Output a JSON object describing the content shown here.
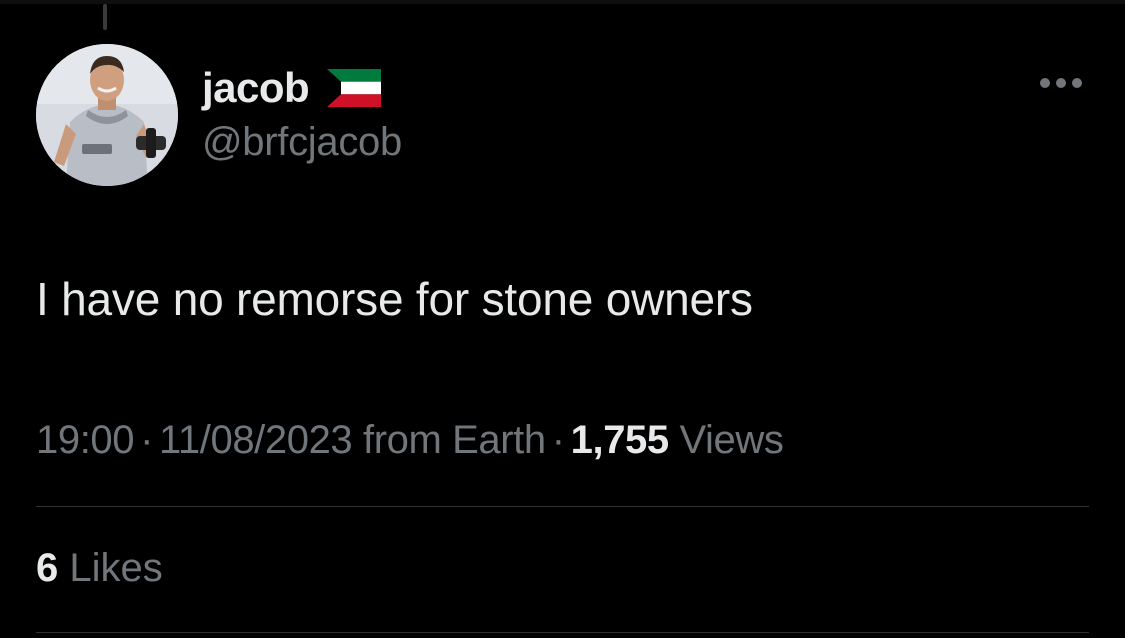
{
  "author": {
    "display_name": "jacob",
    "flag_icon": "kuwait-flag-icon",
    "handle": "@brfcjacob",
    "avatar_icon": "profile-photo"
  },
  "tweet": {
    "text": "I have no remorse for stone owners"
  },
  "meta": {
    "time": "19:00",
    "separator": "·",
    "date": "11/08/2023",
    "source": "from Earth",
    "views_count": "1,755",
    "views_label": "Views"
  },
  "engagement": {
    "likes_count": "6",
    "likes_label": "Likes"
  },
  "colors": {
    "background": "#000000",
    "primary_text": "#e7e9ea",
    "secondary_text": "#71767b",
    "divider": "#2f3336"
  }
}
